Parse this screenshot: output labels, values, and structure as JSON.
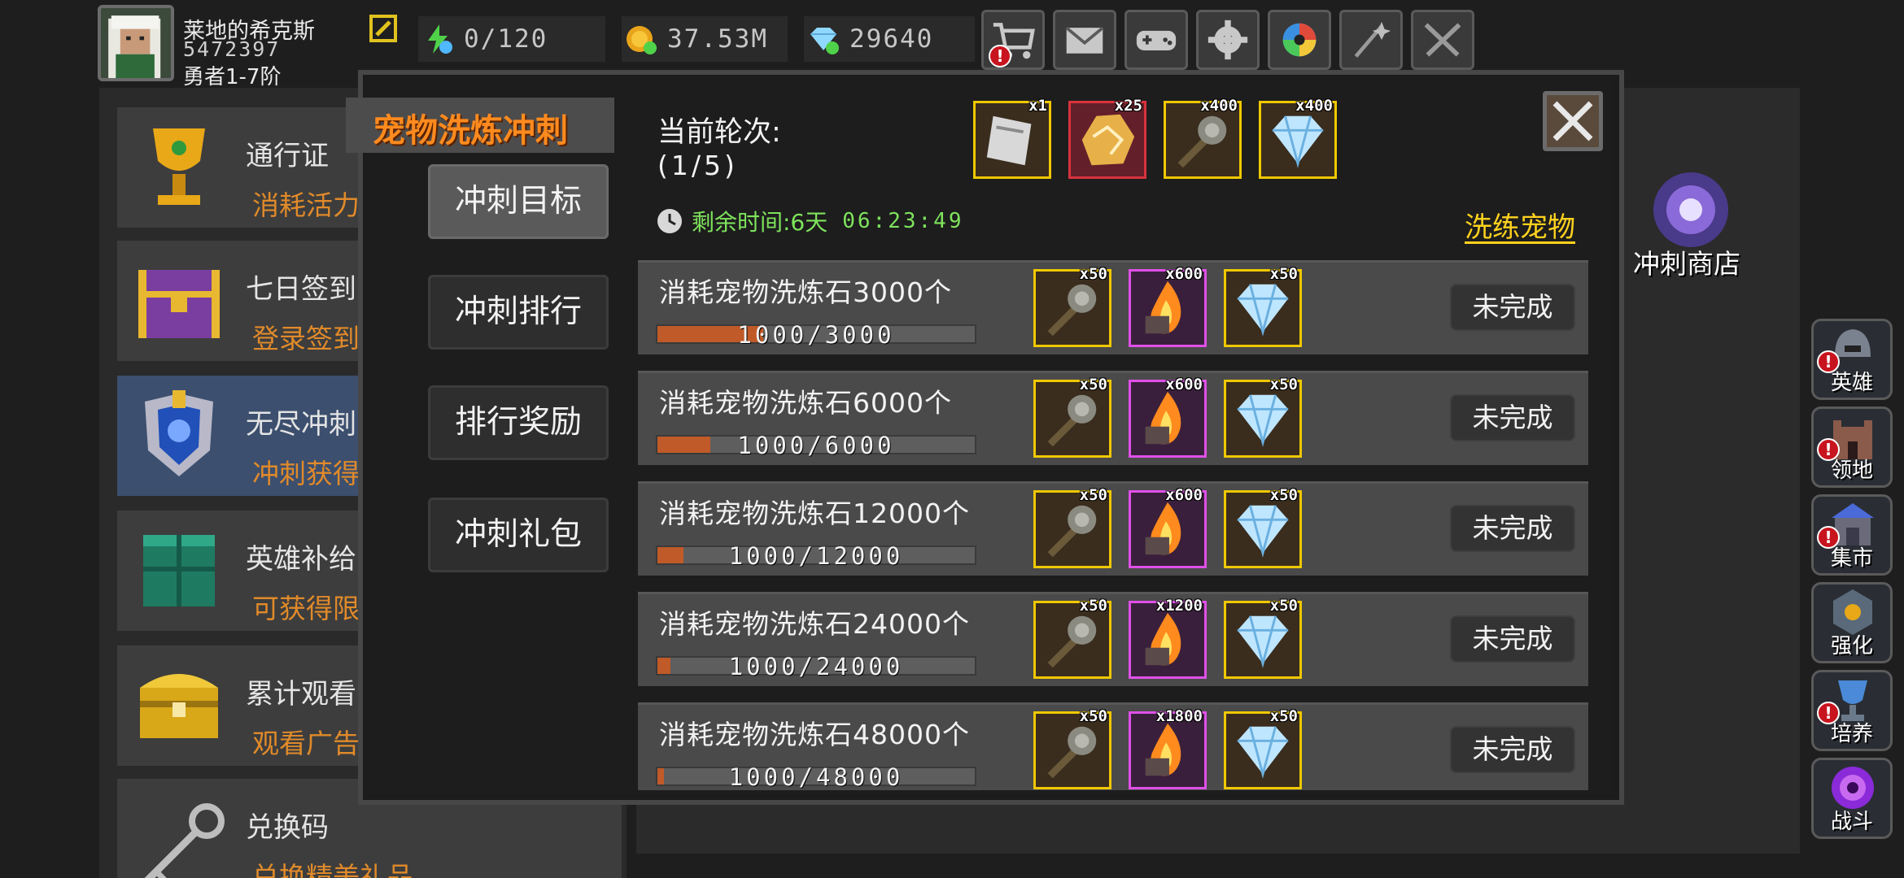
{
  "player": {
    "name": "莱地的希克斯",
    "id": "5472397",
    "rank": "勇者1-7阶"
  },
  "resources": {
    "energy": "0/120",
    "gold": "37.53M",
    "gems": "29640"
  },
  "top_buttons": [
    "cart-icon",
    "mail-icon",
    "gamepad-icon",
    "gear-icon",
    "aperture-icon",
    "sparkle-icon",
    "swords-icon"
  ],
  "left_menu": [
    {
      "title": "通行证",
      "subtitle": "消耗活力拉",
      "icon": "chalice-icon"
    },
    {
      "title": "七日签到",
      "subtitle": "登录签到可",
      "icon": "treasure-chest-icon"
    },
    {
      "title": "无尽冲刺",
      "subtitle": "冲刺获得大",
      "icon": "crest-icon"
    },
    {
      "title": "英雄补给",
      "subtitle": "可获得限定",
      "icon": "supply-crate-icon"
    },
    {
      "title": "累计观看",
      "subtitle": "观看广告就",
      "icon": "golden-chest-icon"
    },
    {
      "title": "兑换码",
      "subtitle": "兑换精美礼品",
      "icon": "key-icon"
    }
  ],
  "modal": {
    "title": "宠物洗炼冲刺",
    "tabs": [
      "冲刺目标",
      "冲刺排行",
      "排行奖励",
      "冲刺礼包"
    ],
    "round_label": "当前轮次:",
    "round_value": "(1/5)",
    "timer_label": "剩余时间:6天",
    "timer_value": "06:23:49",
    "link": "洗练宠物",
    "round_rewards": [
      {
        "icon": "scroll-icon",
        "count": "x1"
      },
      {
        "icon": "gold-ore-icon",
        "count": "x25"
      },
      {
        "icon": "mace-icon",
        "count": "x400"
      },
      {
        "icon": "diamond-icon",
        "count": "x400"
      }
    ],
    "tasks": [
      {
        "title": "消耗宠物洗炼石3000个",
        "progress_text": "1000/3000",
        "progress": 0.333,
        "rewards": [
          "x50",
          "x600",
          "x50"
        ],
        "status": "未完成"
      },
      {
        "title": "消耗宠物洗炼石6000个",
        "progress_text": "1000/6000",
        "progress": 0.167,
        "rewards": [
          "x50",
          "x600",
          "x50"
        ],
        "status": "未完成"
      },
      {
        "title": "消耗宠物洗炼石12000个",
        "progress_text": "1000/12000",
        "progress": 0.083,
        "rewards": [
          "x50",
          "x600",
          "x50"
        ],
        "status": "未完成"
      },
      {
        "title": "消耗宠物洗炼石24000个",
        "progress_text": "1000/24000",
        "progress": 0.042,
        "rewards": [
          "x50",
          "x1200",
          "x50"
        ],
        "status": "未完成"
      },
      {
        "title": "消耗宠物洗炼石48000个",
        "progress_text": "1000/48000",
        "progress": 0.021,
        "rewards": [
          "x50",
          "x1800",
          "x50"
        ],
        "status": "未完成"
      }
    ]
  },
  "shop": {
    "label": "冲刺商店"
  },
  "side_nav": [
    {
      "label": "英雄",
      "alert": true
    },
    {
      "label": "领地",
      "alert": true
    },
    {
      "label": "集市",
      "alert": true
    },
    {
      "label": "强化",
      "alert": false
    },
    {
      "label": "培养",
      "alert": true
    },
    {
      "label": "战斗",
      "alert": false
    }
  ],
  "colors": {
    "accent_orange": "#ff8a1e",
    "link_yellow": "#ffd21e",
    "timer_green": "#7ee35c",
    "progress_fill": "#c05a28",
    "alert_red": "#c8141e"
  }
}
